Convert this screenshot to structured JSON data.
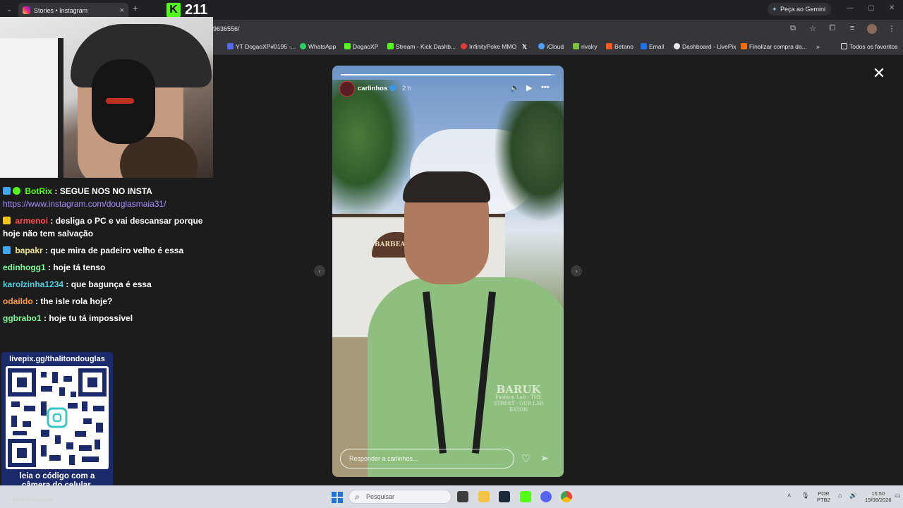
{
  "browser": {
    "tab_title": "Stories • Instagram",
    "tab_close": "×",
    "new_tab": "+",
    "gemini_label": "Peça ao Gemini",
    "url": "9636556/",
    "bookmarks": [
      {
        "label": "YT DogaoXP#0195 -...",
        "color": "#5865f2"
      },
      {
        "label": "WhatsApp",
        "color": "#25d366"
      },
      {
        "label": "DogaoXP",
        "color": "#53fc18"
      },
      {
        "label": "Stream - Kick Dashb...",
        "color": "#53fc18"
      },
      {
        "label": "InfinityPoke MMO",
        "color": "#e53935"
      },
      {
        "label": "",
        "color": "#ffffff"
      },
      {
        "label": "iCloud",
        "color": "#4aa3ff"
      },
      {
        "label": "rivalry",
        "color": "#7cc142"
      },
      {
        "label": "Betano",
        "color": "#ff5a1f"
      },
      {
        "label": "Email",
        "color": "#1a73e8"
      },
      {
        "label": "Dashboard - LivePix",
        "color": "#e8eaed"
      },
      {
        "label": "Finalizar compra da...",
        "color": "#ff6d00"
      }
    ],
    "bookmarks_more": "»",
    "all_favorites": "Todos os favoritos"
  },
  "stream": {
    "kick_viewers": "211",
    "chat": [
      {
        "user": "BotRix",
        "user_color": "#53fc18",
        "text": ": SEGUE NOS NO INSTA",
        "badge_color": "#3fa9f5",
        "badge2_color": "#53fc18"
      },
      {
        "user": "",
        "user_color": "#a98cff",
        "text": "https://www.instagram.com/douglasmaia31/",
        "badge_color": ""
      },
      {
        "user": "armenoi",
        "user_color": "#ff4d4d",
        "text": ": desliga o PC e vai descansar porque hoje não tem salvação",
        "badge_color": "#f5c518"
      },
      {
        "user": "bapakr",
        "user_color": "#f0e68c",
        "text": ": que mira de padeiro velho é essa",
        "badge_color": "#3fa9f5"
      },
      {
        "user": "edinhogg1",
        "user_color": "#7cfc9b",
        "text": ": hoje tá tenso",
        "badge_color": ""
      },
      {
        "user": "karolzinha1234",
        "user_color": "#4dd0e1",
        "text": ": que bagunça é essa",
        "badge_color": ""
      },
      {
        "user": "odaildo",
        "user_color": "#ff9f43",
        "text": ": the isle rola hoje?",
        "badge_color": ""
      },
      {
        "user": "ggbrabo1",
        "user_color": "#7cfc9b",
        "text": ": hoje tu tá impossível",
        "badge_color": ""
      }
    ],
    "livepix": {
      "title": "livepix.gg/thalitondouglas",
      "caption_line1": "leia o código com a",
      "caption_line2": "câmera do celular."
    },
    "weather": "Fred ensolarado"
  },
  "story": {
    "username": "carlinhos",
    "time": "2 h",
    "progress": 0.98,
    "reply_placeholder": "Responder a carlinhos...",
    "sign_text": "BARBEARIA",
    "shirt_brand": "BARUK",
    "shirt_sub": "Fashion Lab · THE STREET · OUR LAB BATON",
    "close": "✕",
    "prev": "‹",
    "next": "›"
  },
  "taskbar": {
    "search_placeholder": "Pesquisar",
    "lang": "POR",
    "lang2": "PTB2",
    "time": "15:50",
    "date": "19/08/2026"
  }
}
